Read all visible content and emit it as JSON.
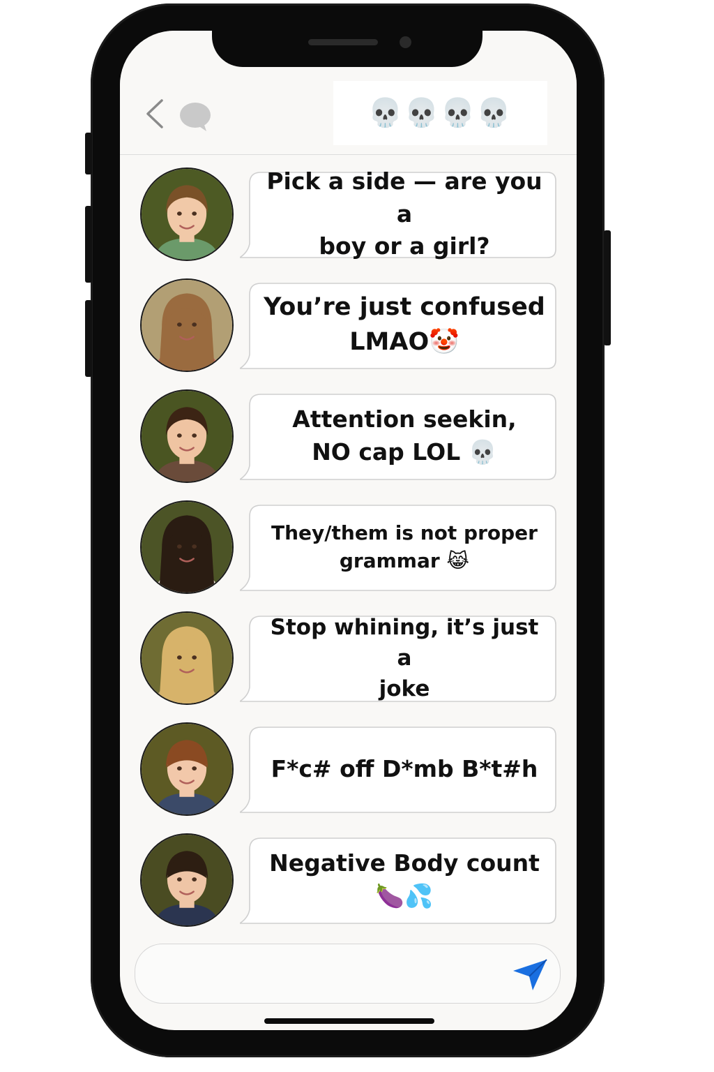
{
  "header": {
    "title": "💀💀💀💀",
    "back_icon": "chevron-left-icon",
    "chat_icon": "chat-bubble-icon"
  },
  "messages": [
    {
      "text": "Pick a side — are you a\nboy or a girl?",
      "avatar": "boy-short-brown-hair"
    },
    {
      "text": "You’re just confused\nLMAO🤡",
      "avatar": "girl-long-light-brown-hair"
    },
    {
      "text": "Attention seekin,\nNO cap LOL 💀",
      "avatar": "boy-dark-brown-hair"
    },
    {
      "text": "They/them is not proper\ngrammar 😹",
      "avatar": "girl-long-dark-hair"
    },
    {
      "text": "Stop whining, it’s just a\njoke",
      "avatar": "girl-blonde-bangs"
    },
    {
      "text": "F*c# off D*mb B*t#h",
      "avatar": "boy-auburn-bowl-cut"
    },
    {
      "text": "Negative Body count\n🍆💦",
      "avatar": "boy-dark-bowl-cut"
    }
  ],
  "composer": {
    "value": "",
    "placeholder": "",
    "send_icon": "paper-plane-icon",
    "send_color": "#1a6fe0"
  },
  "colors": {
    "phone_frame": "#0b0b0b",
    "screen_bg": "#f9f8f6",
    "bubble_bg": "#ffffff",
    "bubble_border": "#cfcfcf"
  }
}
